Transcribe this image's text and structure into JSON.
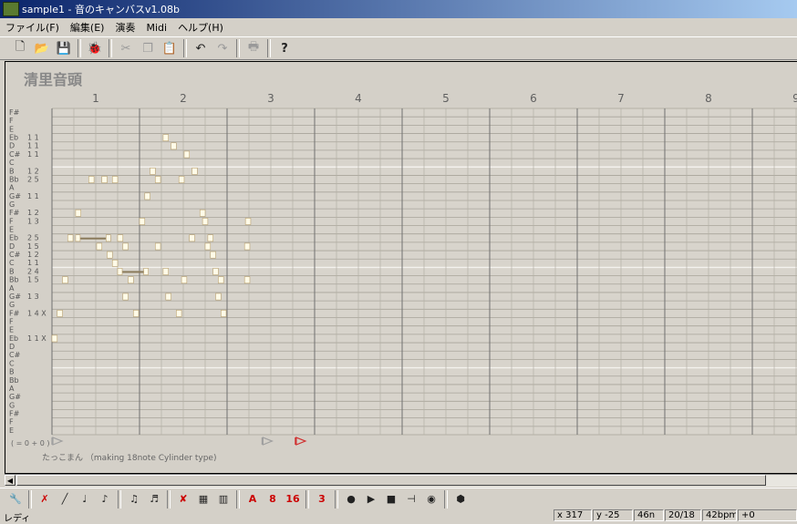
{
  "window": {
    "title": "sample1 - 音のキャンバスv1.08b"
  },
  "menu": [
    "ファイル(F)",
    "編集(E)",
    "演奏",
    "Midi",
    "ヘルプ(H)"
  ],
  "toolbar_icons": [
    "new-file-icon",
    "open-folder-icon",
    "save-icon",
    "import-icon",
    "cut-icon",
    "copy-icon",
    "paste-icon",
    "undo-icon",
    "redo-icon",
    "print-icon",
    "help-icon"
  ],
  "song": {
    "title": "清里音頭",
    "measures": [
      "1",
      "2",
      "3",
      "4",
      "5",
      "6",
      "7",
      "8",
      "9"
    ],
    "note_labels": [
      {
        "name": "F#",
        "count": ""
      },
      {
        "name": "F",
        "count": ""
      },
      {
        "name": "E",
        "count": ""
      },
      {
        "name": "Eb",
        "count": "1 1"
      },
      {
        "name": "D",
        "count": "1 1"
      },
      {
        "name": "C#",
        "count": "1 1"
      },
      {
        "name": "C",
        "count": ""
      },
      {
        "name": "B",
        "count": "1 2"
      },
      {
        "name": "Bb",
        "count": "2 5"
      },
      {
        "name": "A",
        "count": ""
      },
      {
        "name": "G#",
        "count": "1 1"
      },
      {
        "name": "G",
        "count": ""
      },
      {
        "name": "F#",
        "count": "1 2"
      },
      {
        "name": "F",
        "count": "1 3"
      },
      {
        "name": "E",
        "count": ""
      },
      {
        "name": "Eb",
        "count": "2 5"
      },
      {
        "name": "D",
        "count": "1 5"
      },
      {
        "name": "C#",
        "count": "1 2"
      },
      {
        "name": "C",
        "count": "1 1"
      },
      {
        "name": "B",
        "count": "2 4"
      },
      {
        "name": "Bb",
        "count": "1 5"
      },
      {
        "name": "A",
        "count": ""
      },
      {
        "name": "G#",
        "count": "1 3"
      },
      {
        "name": "G",
        "count": ""
      },
      {
        "name": "F#",
        "count": "1 4 X"
      },
      {
        "name": "F",
        "count": ""
      },
      {
        "name": "E",
        "count": ""
      },
      {
        "name": "Eb",
        "count": "1 1 X"
      },
      {
        "name": "D",
        "count": ""
      },
      {
        "name": "C#",
        "count": ""
      },
      {
        "name": "C",
        "count": ""
      },
      {
        "name": "B",
        "count": ""
      },
      {
        "name": "Bb",
        "count": ""
      },
      {
        "name": "A",
        "count": ""
      },
      {
        "name": "G#",
        "count": ""
      },
      {
        "name": "G",
        "count": ""
      },
      {
        "name": "F#",
        "count": ""
      },
      {
        "name": "F",
        "count": ""
      },
      {
        "name": "E",
        "count": ""
      }
    ],
    "footer_left": "( = 0 + 0 )",
    "credit": "たっこまん （making 18note Cylinder type)",
    "notes": [
      {
        "row": 3,
        "beat": 1.27,
        "len": 0.06
      },
      {
        "row": 4,
        "beat": 1.36,
        "len": 0.06
      },
      {
        "row": 5,
        "beat": 1.51,
        "len": 0.06
      },
      {
        "row": 7,
        "beat": 1.12,
        "len": 0.06
      },
      {
        "row": 7,
        "beat": 1.6,
        "len": 0.06
      },
      {
        "row": 8,
        "beat": 0.42,
        "len": 0.06
      },
      {
        "row": 8,
        "beat": 0.57,
        "len": 0.06
      },
      {
        "row": 8,
        "beat": 0.69,
        "len": 0.06
      },
      {
        "row": 8,
        "beat": 1.18,
        "len": 0.06
      },
      {
        "row": 8,
        "beat": 1.45,
        "len": 0.06
      },
      {
        "row": 10,
        "beat": 1.06,
        "len": 0.06
      },
      {
        "row": 12,
        "beat": 0.27,
        "len": 0.06
      },
      {
        "row": 12,
        "beat": 1.69,
        "len": 0.06
      },
      {
        "row": 13,
        "beat": 1.0,
        "len": 0.06
      },
      {
        "row": 13,
        "beat": 1.72,
        "len": 0.06
      },
      {
        "row": 13,
        "beat": 2.21,
        "len": 0.06
      },
      {
        "row": 15,
        "beat": 0.18,
        "len": 0.06
      },
      {
        "row": 15,
        "beat": 0.27,
        "len": 0.4
      },
      {
        "row": 15,
        "beat": 0.75,
        "len": 0.06
      },
      {
        "row": 15,
        "beat": 1.57,
        "len": 0.06
      },
      {
        "row": 15,
        "beat": 1.78,
        "len": 0.06
      },
      {
        "row": 16,
        "beat": 0.51,
        "len": 0.06
      },
      {
        "row": 16,
        "beat": 0.81,
        "len": 0.06
      },
      {
        "row": 16,
        "beat": 1.18,
        "len": 0.06
      },
      {
        "row": 16,
        "beat": 1.75,
        "len": 0.06
      },
      {
        "row": 16,
        "beat": 2.2,
        "len": 0.06
      },
      {
        "row": 17,
        "beat": 0.63,
        "len": 0.06
      },
      {
        "row": 17,
        "beat": 1.81,
        "len": 0.06
      },
      {
        "row": 18,
        "beat": 0.69,
        "len": 0.06
      },
      {
        "row": 19,
        "beat": 0.75,
        "len": 0.35
      },
      {
        "row": 19,
        "beat": 1.27,
        "len": 0.06
      },
      {
        "row": 19,
        "beat": 1.84,
        "len": 0.06
      },
      {
        "row": 20,
        "beat": 0.12,
        "len": 0.06
      },
      {
        "row": 20,
        "beat": 0.87,
        "len": 0.06
      },
      {
        "row": 20,
        "beat": 1.48,
        "len": 0.06
      },
      {
        "row": 20,
        "beat": 1.9,
        "len": 0.06
      },
      {
        "row": 20,
        "beat": 2.2,
        "len": 0.06
      },
      {
        "row": 22,
        "beat": 0.81,
        "len": 0.06
      },
      {
        "row": 22,
        "beat": 1.3,
        "len": 0.06
      },
      {
        "row": 22,
        "beat": 1.87,
        "len": 0.06
      },
      {
        "row": 24,
        "beat": 0.06,
        "len": 0.06
      },
      {
        "row": 24,
        "beat": 0.93,
        "len": 0.06
      },
      {
        "row": 24,
        "beat": 1.42,
        "len": 0.06
      },
      {
        "row": 24,
        "beat": 1.93,
        "len": 0.06
      },
      {
        "row": 27,
        "beat": 0.0,
        "len": 0.06
      }
    ],
    "markers": [
      {
        "beat": 0.0,
        "color": "#a0a0a0"
      },
      {
        "beat": 2.4,
        "color": "#a0a0a0"
      },
      {
        "beat": 2.78,
        "color": "#d03030"
      }
    ]
  },
  "toolbar2_icons": [
    "wrench-icon",
    "pen-eraser-icon",
    "line-icon",
    "note-tool-icon",
    "note-tool2-icon",
    "mark-icon",
    "double-note-icon",
    "erase-note-icon",
    "grid-icon",
    "bar-icon",
    "note-a-icon",
    "note-8-icon",
    "note-16-icon",
    "note-3-icon",
    "record-icon",
    "play-icon",
    "stop-icon",
    "step-icon",
    "loop-icon",
    "cylinder-icon"
  ],
  "toolbar2_labels": [
    "A",
    "8",
    "16",
    "3"
  ],
  "status": {
    "left": "レディ",
    "x": "x  317",
    "y": "y  -25",
    "note": "46n",
    "pos": "20/18",
    "bpm": "42bpm",
    "extra": "+0"
  },
  "colors": {
    "note": "#fffbe8",
    "grid_major": "#808080",
    "grid_minor": "#b8b4aa",
    "title_bar": "#0a246a"
  }
}
